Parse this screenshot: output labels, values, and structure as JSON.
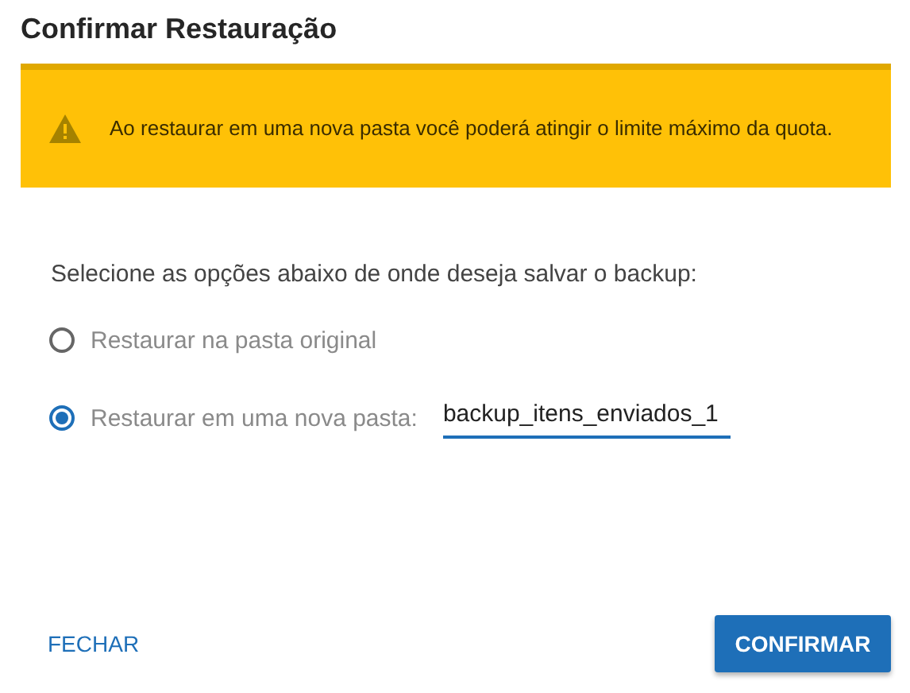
{
  "dialog": {
    "title": "Confirmar Restauração"
  },
  "warning": {
    "text": "Ao restaurar em uma nova pasta você poderá atingir o limite máximo da quota."
  },
  "instruction": "Selecione as opções abaixo de onde deseja salvar o backup:",
  "options": [
    {
      "kind": "plain",
      "label": "Restaurar na pasta original",
      "selected": false
    },
    {
      "kind": "with_field",
      "label": "Restaurar em uma nova pasta:",
      "selected": true,
      "field": {
        "value": "backup_itens_enviados_1"
      }
    }
  ],
  "buttons": [
    {
      "kind": "text",
      "label": "FECHAR"
    },
    {
      "kind": "primary",
      "label": "CONFIRMAR"
    }
  ]
}
